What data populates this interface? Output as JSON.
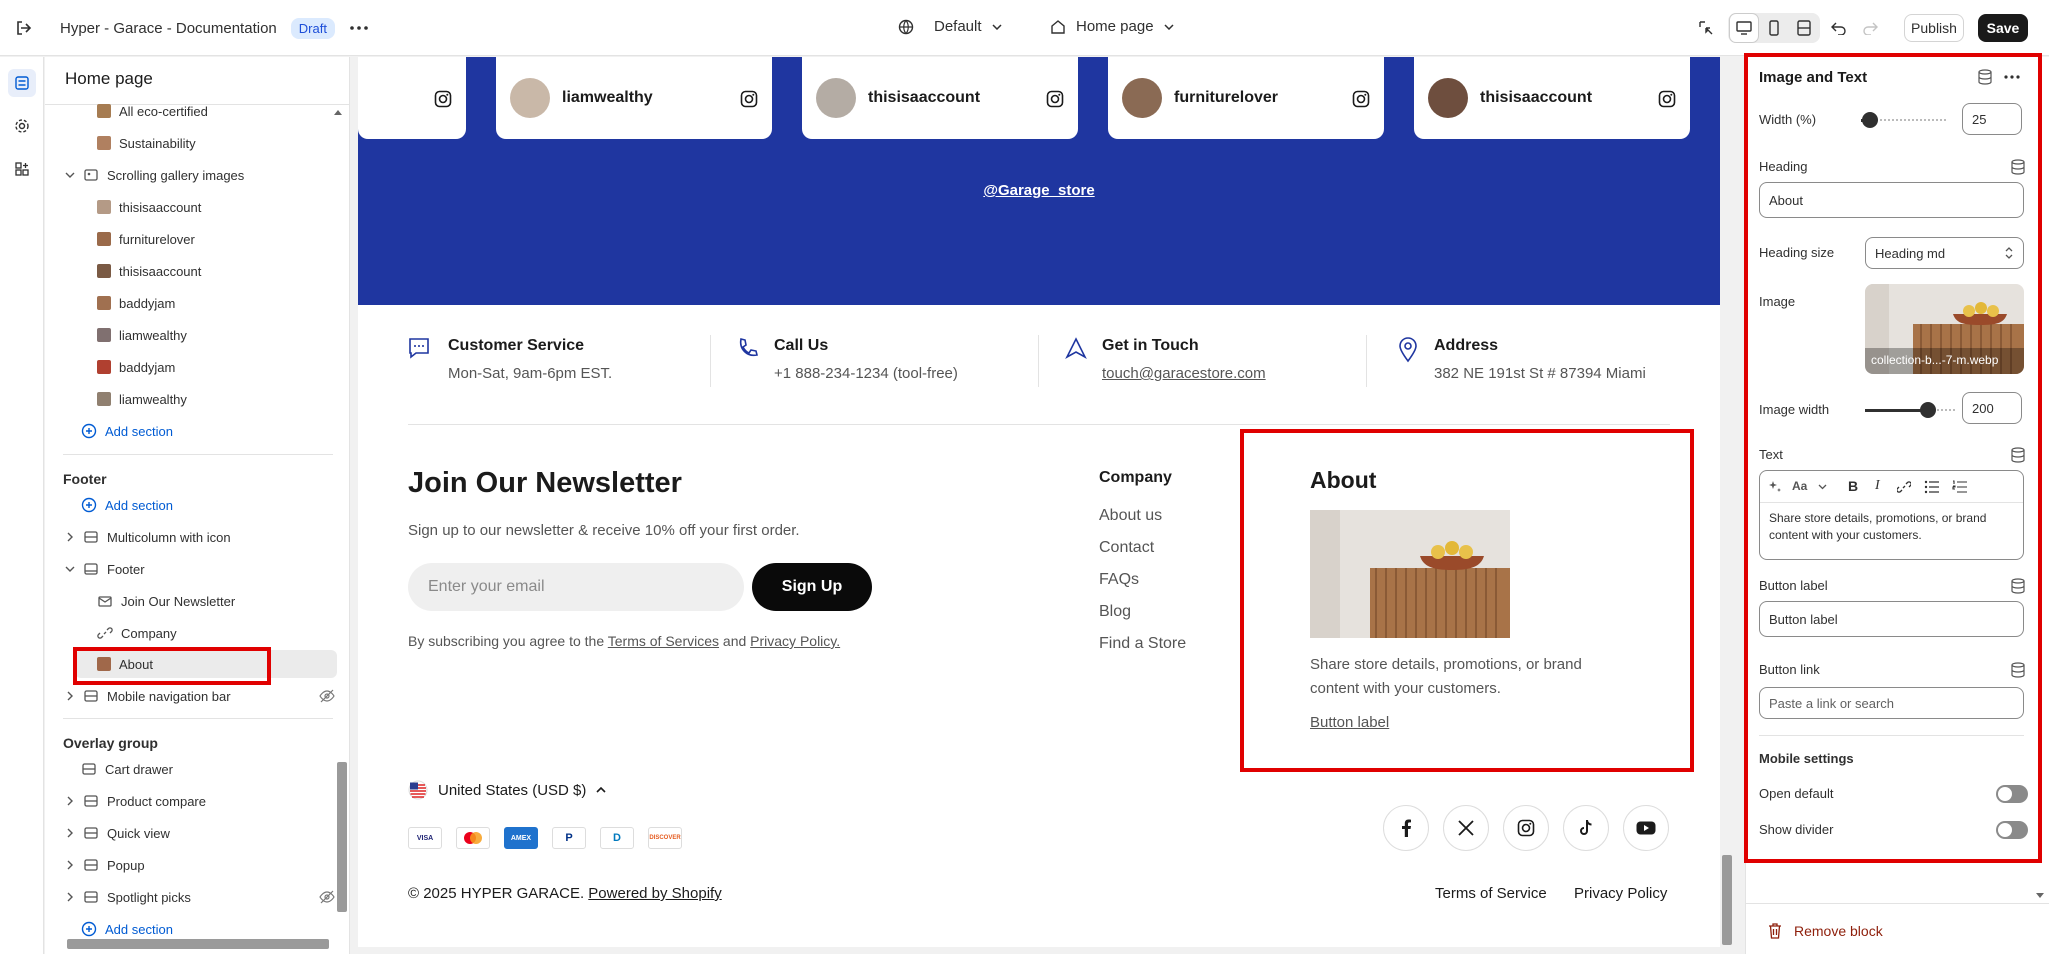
{
  "topbar": {
    "title": "Hyper - Garace - Documentation",
    "status": "Draft",
    "theme": "Default",
    "page": "Home page",
    "publish": "Publish",
    "save": "Save"
  },
  "tree": {
    "title": "Home page",
    "items": [
      {
        "label": "All eco-certified",
        "color": "#a67c52"
      },
      {
        "label": "Sustainability",
        "color": "#b08060"
      },
      {
        "label": "Scrolling gallery images"
      },
      {
        "label": "thisisaaccount",
        "color": "#b49a86"
      },
      {
        "label": "furniturelover",
        "color": "#9a6a4a"
      },
      {
        "label": "thisisaaccount",
        "color": "#7a5a44"
      },
      {
        "label": "baddyjam",
        "color": "#a07050"
      },
      {
        "label": "liamwealthy",
        "color": "#807070"
      },
      {
        "label": "baddyjam",
        "color": "#b04030"
      },
      {
        "label": "liamwealthy",
        "color": "#908070"
      }
    ],
    "add_section": "Add section",
    "footer_group": "Footer",
    "footer_items": [
      "Multicolumn with icon",
      "Footer",
      "Join Our Newsletter",
      "Company",
      "About",
      "Mobile navigation bar"
    ],
    "overlay_group": "Overlay group",
    "overlay_items": [
      "Cart drawer",
      "Product compare",
      "Quick view",
      "Popup",
      "Spotlight picks"
    ]
  },
  "gallery": {
    "cards": [
      "liamwealthy",
      "thisisaaccount",
      "furniturelover",
      "thisisaaccount"
    ],
    "handle": "@Garage_store"
  },
  "features": [
    {
      "title": "Customer Service",
      "text": "Mon-Sat, 9am-6pm EST."
    },
    {
      "title": "Call Us",
      "text": "+1 888-234-1234 (tool-free)"
    },
    {
      "title": "Get in Touch",
      "text": "touch@garacestore.com"
    },
    {
      "title": "Address",
      "text": "382 NE 191st St # 87394 Miami"
    }
  ],
  "newsletter": {
    "title": "Join Our Newsletter",
    "subtitle": "Sign up to our newsletter & receive 10% off your first order.",
    "placeholder": "Enter your email",
    "button": "Sign Up",
    "legal_pre": "By subscribing you agree to the",
    "terms": "Terms of Services",
    "and": "and",
    "privacy": "Privacy Policy."
  },
  "company": {
    "title": "Company",
    "links": [
      "About us",
      "Contact",
      "FAQs",
      "Blog",
      "Find a Store"
    ]
  },
  "about": {
    "title": "About",
    "text": "Share store details, promotions, or brand content with your customers.",
    "button": "Button label"
  },
  "bottom": {
    "currency": "United States (USD $)",
    "payments": [
      "VISA",
      "MC",
      "AMEX",
      "P",
      "D",
      "DISCOVER"
    ],
    "copyright": "© 2025 HYPER GARACE.",
    "powered": "Powered by Shopify",
    "terms": "Terms of Service",
    "privacy": "Privacy Policy"
  },
  "panel": {
    "title": "Image and Text",
    "width_label": "Width (%)",
    "width_value": "25",
    "width_fraction": 0.1,
    "heading_label": "Heading",
    "heading_value": "About",
    "heading_size_label": "Heading size",
    "heading_size_value": "Heading md",
    "image_label": "Image",
    "image_filename": "collection-b...-7-m.webp",
    "image_width_label": "Image width",
    "image_width_value": "200",
    "image_width_fraction": 0.7,
    "text_label": "Text",
    "text_value": "Share store details, promotions, or brand content with your customers.",
    "button_label_label": "Button label",
    "button_label_value": "Button label",
    "button_link_label": "Button link",
    "button_link_placeholder": "Paste a link or search",
    "mobile_settings": "Mobile settings",
    "open_default": "Open default",
    "show_divider": "Show divider",
    "remove_block": "Remove block"
  }
}
